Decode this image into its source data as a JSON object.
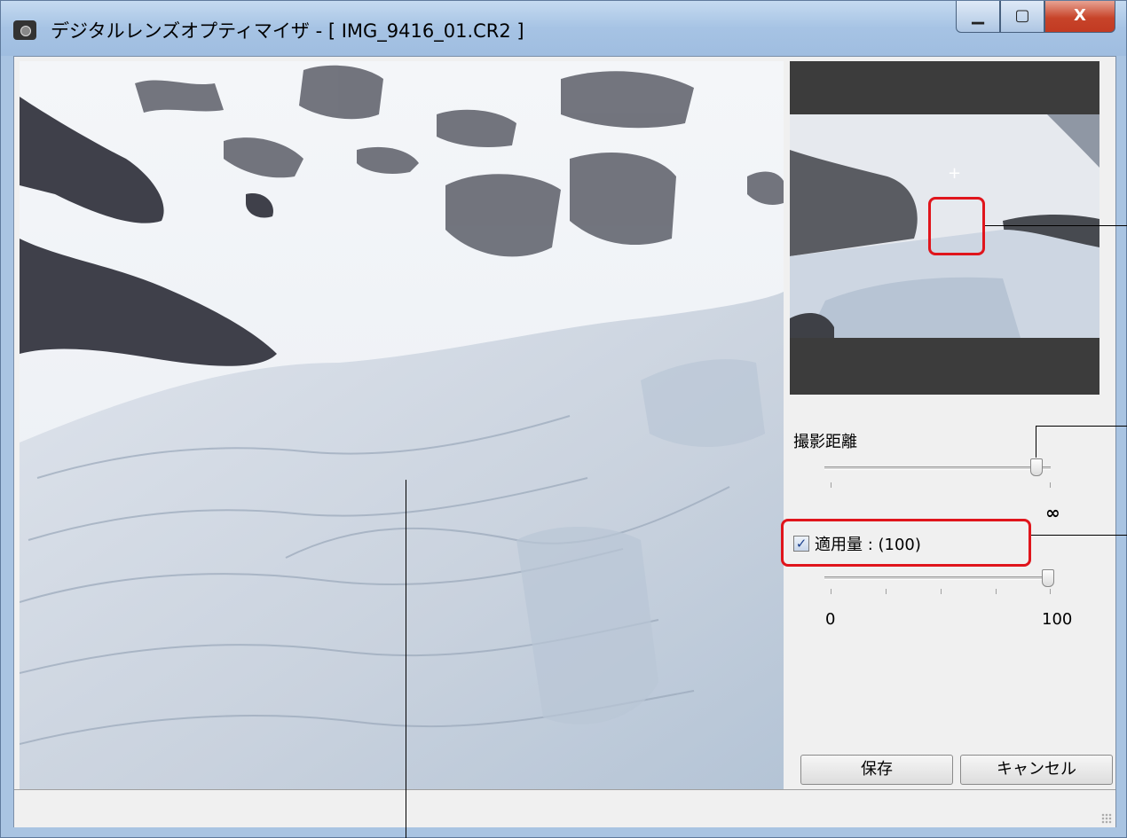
{
  "window": {
    "title": "デジタルレンズオプティマイザ - [ IMG_9416_01.CR2 ]",
    "minimize_glyph": "▁",
    "maximize_glyph": "▢",
    "close_glyph": "X"
  },
  "panel": {
    "shooting_distance_label": "撮影距離",
    "infinity_label": "∞",
    "shooting_distance_value": 1.0,
    "apply_amount_checked": true,
    "apply_amount_label": "適用量 : (100)",
    "apply_amount_value": 100,
    "apply_min_label": "0",
    "apply_max_label": "100",
    "preview_cursor": "+"
  },
  "buttons": {
    "save": "保存",
    "cancel": "キャンセル"
  },
  "icons": {
    "app": "camera-icon",
    "check": "✓",
    "resize": "size-grip-icon"
  },
  "colors": {
    "highlight": "#e0151c",
    "titlebar": "#a6c3e4",
    "close": "#c7442a"
  }
}
